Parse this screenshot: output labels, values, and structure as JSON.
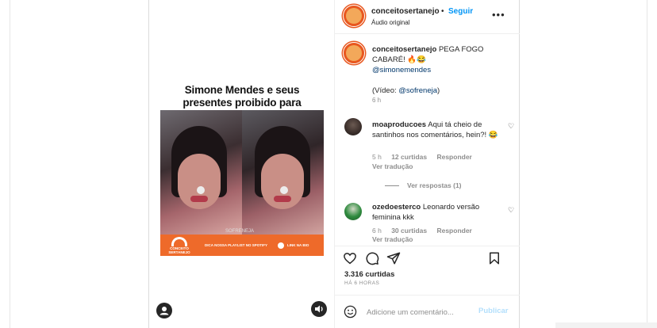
{
  "media": {
    "overlay_title": "Simone Mendes e seus presentes proibido para menores!",
    "overlay_emojis": "🔞😳🔥",
    "watermark": "SOFRENEJA",
    "banner": {
      "logo_text": "CONCEITO SERTANEJO",
      "promo_text": "DICA NOSSA PLAYLIST NO SPOTIFY",
      "link_text": "LINK NA BIO"
    }
  },
  "post": {
    "author": "conceitosertanejo",
    "dot": "•",
    "follow_label": "Seguir",
    "audio_label": "Áudio original",
    "more_label": "•••",
    "avatar_text": "CON\nCEITO"
  },
  "caption": {
    "author": "conceitosertanejo",
    "text": "PEGA FOGO CABARÉ! 🔥😂",
    "mention": "@simonemendes",
    "video_prefix": "(Vídeo: ",
    "video_mention": "@sofreneja",
    "video_suffix": ")",
    "time": "6 h"
  },
  "comments": [
    {
      "author": "moaproducoes",
      "text": "Aqui tá cheio de santinhos nos comentários, hein?! 😂",
      "time": "5 h",
      "likes": "12 curtidas",
      "reply_label": "Responder",
      "translate_label": "Ver tradução",
      "view_replies": "Ver respostas (1)"
    },
    {
      "author": "ozedoesterco",
      "text": "Leonardo versão feminina kkk",
      "time": "6 h",
      "likes": "30 curtidas",
      "reply_label": "Responder",
      "translate_label": "Ver tradução"
    }
  ],
  "actions": {
    "likes_count": "3.316 curtidas",
    "posted_ago": "HÁ 6 HORAS"
  },
  "composer": {
    "placeholder": "Adicione um comentário...",
    "publish_label": "Publicar"
  },
  "colors": {
    "accent_blue": "#0095f6",
    "brand_orange": "#ee6a2a",
    "link": "#00376b",
    "muted": "#8e8e8e"
  }
}
